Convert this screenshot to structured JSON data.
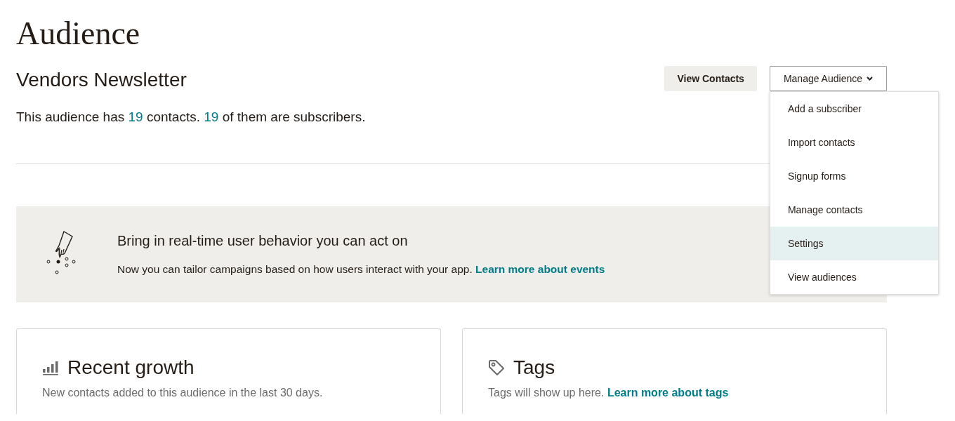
{
  "page": {
    "title": "Audience"
  },
  "audience": {
    "name": "Vendors Newsletter",
    "summary": "This audience has **19** contacts. **19** of them are subscribers."
  },
  "buttons": {
    "view_contacts": "View Contacts",
    "manage_audience": "Manage Audience"
  },
  "menu": {
    "open": true,
    "items": [
      {
        "label": "Add a subscriber",
        "highlighted": false
      },
      {
        "label": "Import contacts",
        "highlighted": false
      },
      {
        "label": "Signup forms",
        "highlighted": false
      },
      {
        "label": "Manage contacts",
        "highlighted": false
      },
      {
        "label": "Settings",
        "highlighted": true
      },
      {
        "label": "View audiences",
        "highlighted": false
      }
    ]
  },
  "banner": {
    "title": "Bring in real-time user behavior you can act on",
    "text": "Now you can tailor campaigns based on how users interact with your app.",
    "link": "Learn more about events"
  },
  "cards": [
    {
      "kind": "growth",
      "title": "Recent growth",
      "text": "New contacts added to this audience in the last 30 days."
    },
    {
      "kind": "tags",
      "title": "Tags",
      "text": "Tags will show up here.",
      "link": "Learn more about tags"
    }
  ]
}
